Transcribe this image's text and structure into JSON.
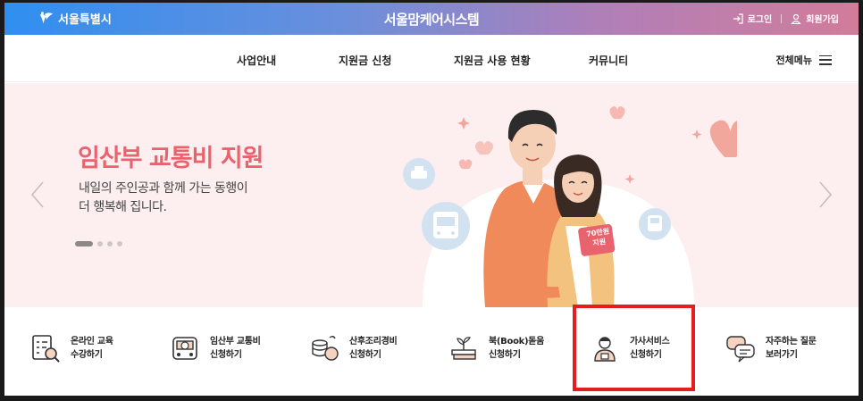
{
  "header": {
    "logo_text": "서울특별시",
    "system_title": "서울맘케어시스템",
    "login_label": "로그인",
    "signup_label": "회원가입",
    "gradient_start": "#2f8ff0",
    "gradient_end": "#d27c9a"
  },
  "nav": {
    "items": [
      "사업안내",
      "지원금 신청",
      "지원금 사용 현황",
      "커뮤니티"
    ],
    "all_menu_label": "전체메뉴"
  },
  "hero": {
    "title": "임산부 교통비 지원",
    "subtitle_line1": "내일의 주인공과 함께 가는 동행이",
    "subtitle_line2": "더 행복해 집니다.",
    "card_line1": "70만원",
    "card_line2": "지원",
    "slide_count": 4,
    "active_slide": 1,
    "title_color": "#e8636e",
    "background": "#fdefef"
  },
  "quick_menu": [
    {
      "line1": "온라인 교육",
      "line2": "수강하기",
      "icon": "checklist-search-icon"
    },
    {
      "line1": "임산부 교통비",
      "line2": "신청하기",
      "icon": "bus-icon"
    },
    {
      "line1": "산후조리경비",
      "line2": "신청하기",
      "icon": "coins-icon"
    },
    {
      "line1": "북(Book)돋움",
      "line2": "신청하기",
      "icon": "books-plant-icon"
    },
    {
      "line1": "가사서비스",
      "line2": "신청하기",
      "icon": "housekeeper-icon"
    },
    {
      "line1": "자주하는 질문",
      "line2": "보러가기",
      "icon": "chat-bubbles-icon"
    }
  ],
  "highlight_color": "#e41e1e"
}
